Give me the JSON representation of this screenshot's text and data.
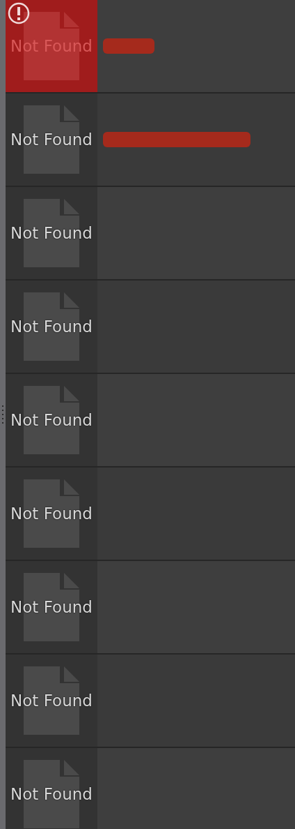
{
  "items": [
    {
      "thumbnail_label": "Not Found",
      "error": true,
      "kind": "short_redacted"
    },
    {
      "thumbnail_label": "Not Found",
      "error": false,
      "kind": "long_redacted"
    },
    {
      "thumbnail_label": "Not Found",
      "error": false
    },
    {
      "thumbnail_label": "Not Found",
      "error": false
    },
    {
      "thumbnail_label": "Not Found",
      "error": false
    },
    {
      "thumbnail_label": "Not Found",
      "error": false
    },
    {
      "thumbnail_label": "Not Found",
      "error": false
    },
    {
      "thumbnail_label": "Not Found",
      "error": false
    },
    {
      "thumbnail_label": "Not Found",
      "error": false
    }
  ]
}
